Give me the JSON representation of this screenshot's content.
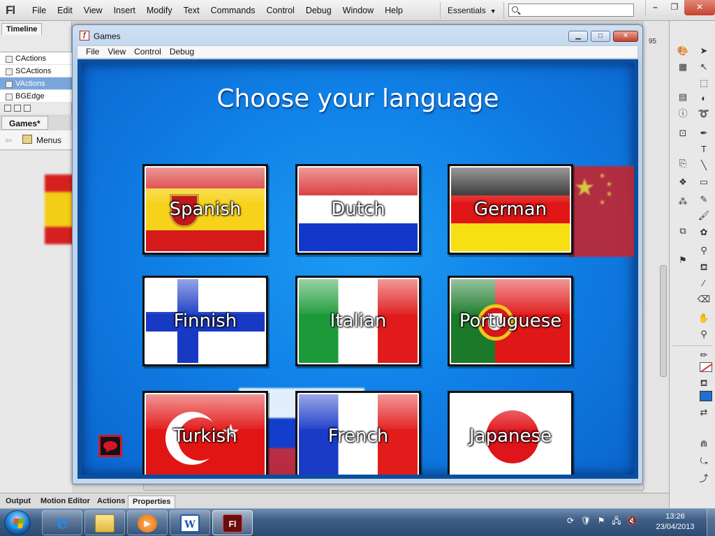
{
  "ide": {
    "logo": "Fl",
    "menu": [
      "File",
      "Edit",
      "View",
      "Insert",
      "Modify",
      "Text",
      "Commands",
      "Control",
      "Debug",
      "Window",
      "Help"
    ],
    "workspace": "Essentials",
    "search": {
      "value": "",
      "placeholder": ""
    },
    "timeline_tab": "Timeline",
    "frame_number": "95",
    "layers": [
      "CActions",
      "SCActions",
      "VActions",
      "BGEdge"
    ],
    "selected_layer": "VActions",
    "document_tab": "Games*",
    "breadcrumb_label": "Menus",
    "bottom_tabs": [
      "Output",
      "Motion Editor",
      "Actions",
      "Properties"
    ],
    "active_bottom_tab": "Properties",
    "accent_color": "#7aa6dc"
  },
  "player": {
    "title": "Games",
    "menu": [
      "File",
      "View",
      "Control",
      "Debug"
    ],
    "heading": "Choose your language",
    "background_color": "#1082e8",
    "languages": [
      {
        "label": "Spanish",
        "flag": "spain-flag"
      },
      {
        "label": "Dutch",
        "flag": "netherlands-flag"
      },
      {
        "label": "German",
        "flag": "germany-flag"
      },
      {
        "label": "Finnish",
        "flag": "finland-flag"
      },
      {
        "label": "Italian",
        "flag": "italy-flag"
      },
      {
        "label": "Portuguese",
        "flag": "portugal-flag"
      },
      {
        "label": "Turkish",
        "flag": "turkey-flag"
      },
      {
        "label": "French",
        "flag": "france-flag"
      },
      {
        "label": "Japanese",
        "flag": "japan-flag"
      }
    ],
    "speech_button_icon": "speech-bubble-icon"
  },
  "taskbar": {
    "apps": [
      "internet-explorer-icon",
      "windows-explorer-icon",
      "media-player-icon",
      "word-icon",
      "flash-icon"
    ],
    "word_glyph": "W",
    "flash_glyph": "Fl",
    "active_app": "flash-icon",
    "clock_time": "13:26",
    "clock_date": "23/04/2013"
  }
}
